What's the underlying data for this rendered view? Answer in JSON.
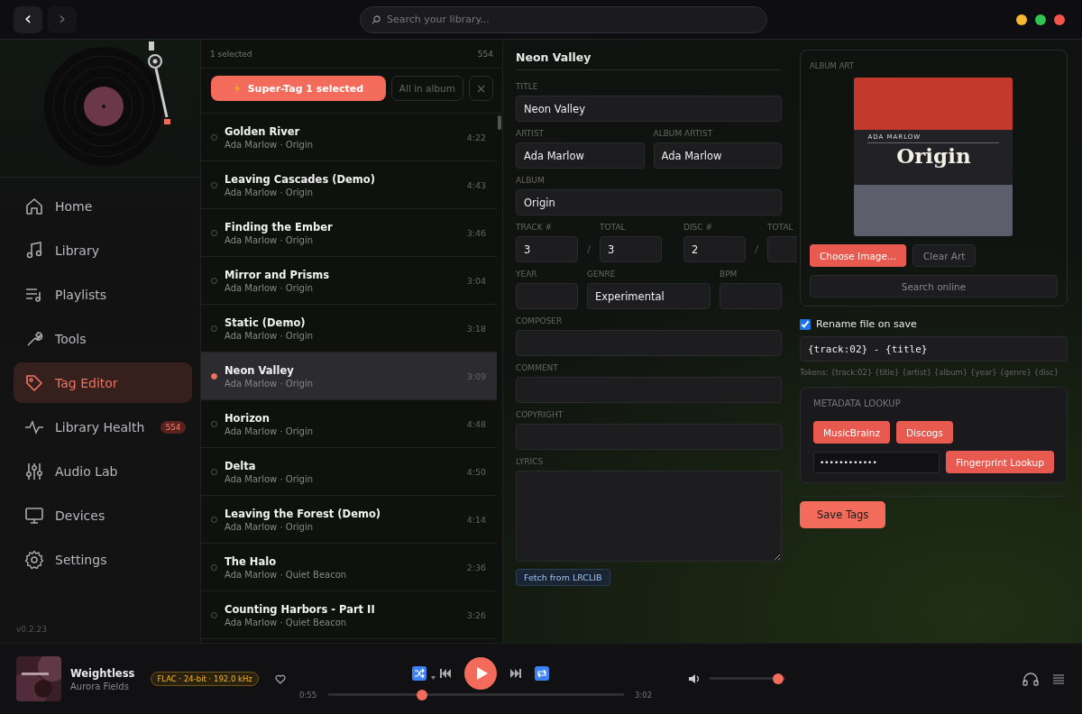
{
  "topbar": {
    "back": "‹",
    "forward": "›",
    "search": {
      "placeholder": "Search your library..."
    },
    "window_controls": [
      {
        "color": "#f5b82e"
      },
      {
        "color": "#2fc452"
      },
      {
        "color": "#f2544c"
      }
    ]
  },
  "sidebar": {
    "items": [
      {
        "label": "Home",
        "selected": false
      },
      {
        "label": "Library",
        "selected": false
      },
      {
        "label": "Playlists",
        "selected": false
      },
      {
        "label": "Tools",
        "selected": false
      },
      {
        "label": "Tag Editor",
        "selected": true
      },
      {
        "label": "Library Health",
        "selected": false,
        "badge": "554"
      },
      {
        "label": "Audio Lab",
        "selected": false
      },
      {
        "label": "Devices",
        "selected": false
      },
      {
        "label": "Settings",
        "selected": false
      }
    ],
    "version": "v0.2.23"
  },
  "tracklist": {
    "selected_count": "1 selected",
    "total": "554",
    "super_tag": "Super-Tag 1 selected",
    "all_in_album": "All in album",
    "clear": "×",
    "tracks": [
      {
        "title": "Golden River",
        "subtitle": "Ada Marlow · Origin",
        "duration": "4:22",
        "selected": false
      },
      {
        "title": "Leaving Cascades (Demo)",
        "subtitle": "Ada Marlow · Origin",
        "duration": "4:43",
        "selected": false
      },
      {
        "title": "Finding the Ember",
        "subtitle": "Ada Marlow · Origin",
        "duration": "3:46",
        "selected": false
      },
      {
        "title": "Mirror and Prisms",
        "subtitle": "Ada Marlow · Origin",
        "duration": "3:04",
        "selected": false
      },
      {
        "title": "Static (Demo)",
        "subtitle": "Ada Marlow · Origin",
        "duration": "3:18",
        "selected": false
      },
      {
        "title": "Neon Valley",
        "subtitle": "Ada Marlow · Origin",
        "duration": "3:09",
        "selected": true
      },
      {
        "title": "Horizon",
        "subtitle": "Ada Marlow · Origin",
        "duration": "4:48",
        "selected": false
      },
      {
        "title": "Delta",
        "subtitle": "Ada Marlow · Origin",
        "duration": "4:50",
        "selected": false
      },
      {
        "title": "Leaving the Forest (Demo)",
        "subtitle": "Ada Marlow · Origin",
        "duration": "4:14",
        "selected": false
      },
      {
        "title": "The Halo",
        "subtitle": "Ada Marlow · Quiet Beacon",
        "duration": "2:36",
        "selected": false
      },
      {
        "title": "Counting Harbors - Part II",
        "subtitle": "Ada Marlow · Quiet Beacon",
        "duration": "3:26",
        "selected": false
      }
    ]
  },
  "editor": {
    "heading": "Neon Valley",
    "rows": [
      {
        "items": [
          {
            "kind": "field",
            "label": "TITLE",
            "value": "Neon Valley"
          }
        ]
      },
      {
        "items": [
          {
            "kind": "field",
            "label": "ARTIST",
            "value": "Ada Marlow"
          },
          {
            "kind": "field",
            "label": "ALBUM ARTIST",
            "value": "Ada Marlow"
          }
        ]
      },
      {
        "items": [
          {
            "kind": "field",
            "label": "ALBUM",
            "value": "Origin"
          }
        ]
      },
      {
        "items": [
          {
            "kind": "field",
            "label": "TRACK #",
            "value": "3"
          },
          {
            "kind": "separator",
            "text": "/"
          },
          {
            "kind": "field",
            "label": "TOTAL",
            "value": "3"
          },
          {
            "kind": "field",
            "label": "DISC #",
            "value": "2"
          },
          {
            "kind": "separator",
            "text": "/"
          },
          {
            "kind": "field",
            "label": "TOTAL"
          }
        ]
      },
      {
        "items": [
          {
            "kind": "field",
            "label": "YEAR"
          },
          {
            "kind": "field",
            "label": "GENRE",
            "value": "Experimental"
          },
          {
            "kind": "field",
            "label": "BPM"
          }
        ]
      },
      {
        "items": [
          {
            "kind": "field",
            "label": "COMPOSER"
          }
        ]
      },
      {
        "items": [
          {
            "kind": "field",
            "label": "COMMENT"
          }
        ]
      },
      {
        "items": [
          {
            "kind": "field",
            "label": "COPYRIGHT"
          }
        ]
      }
    ],
    "lyrics": {
      "label": "LYRICS"
    },
    "fetch_button": "Fetch from LRCLIB",
    "album_art": {
      "label": "ALBUM ART",
      "cover_artist": "ADA MARLOW",
      "cover_title": "Origin",
      "choose": "Choose Image...",
      "clear": "Clear Art",
      "search": "Search online"
    },
    "rename": {
      "label": "Rename file on save",
      "checked": true,
      "pattern": "{track:02} - {title}",
      "tokens": "Tokens: {track:02} {title} {artist} {album} {year} {genre} {disc}"
    },
    "lookup": {
      "label": "METADATA LOOKUP",
      "buttons": [
        "MusicBrainz",
        "Discogs"
      ],
      "key": "••••••••••••",
      "fingerprint": "Fingerprint Lookup"
    },
    "save": "Save Tags"
  },
  "player": {
    "title": "Weightless",
    "artist": "Aurora Fields",
    "format": "FLAC · 24-bit · 192.0 kHz",
    "shuffle": true,
    "repeat": true,
    "elapsed": "0:55",
    "duration": "3:02",
    "progress": {
      "level": 0.31
    },
    "volume": {
      "level": 0.97
    }
  }
}
